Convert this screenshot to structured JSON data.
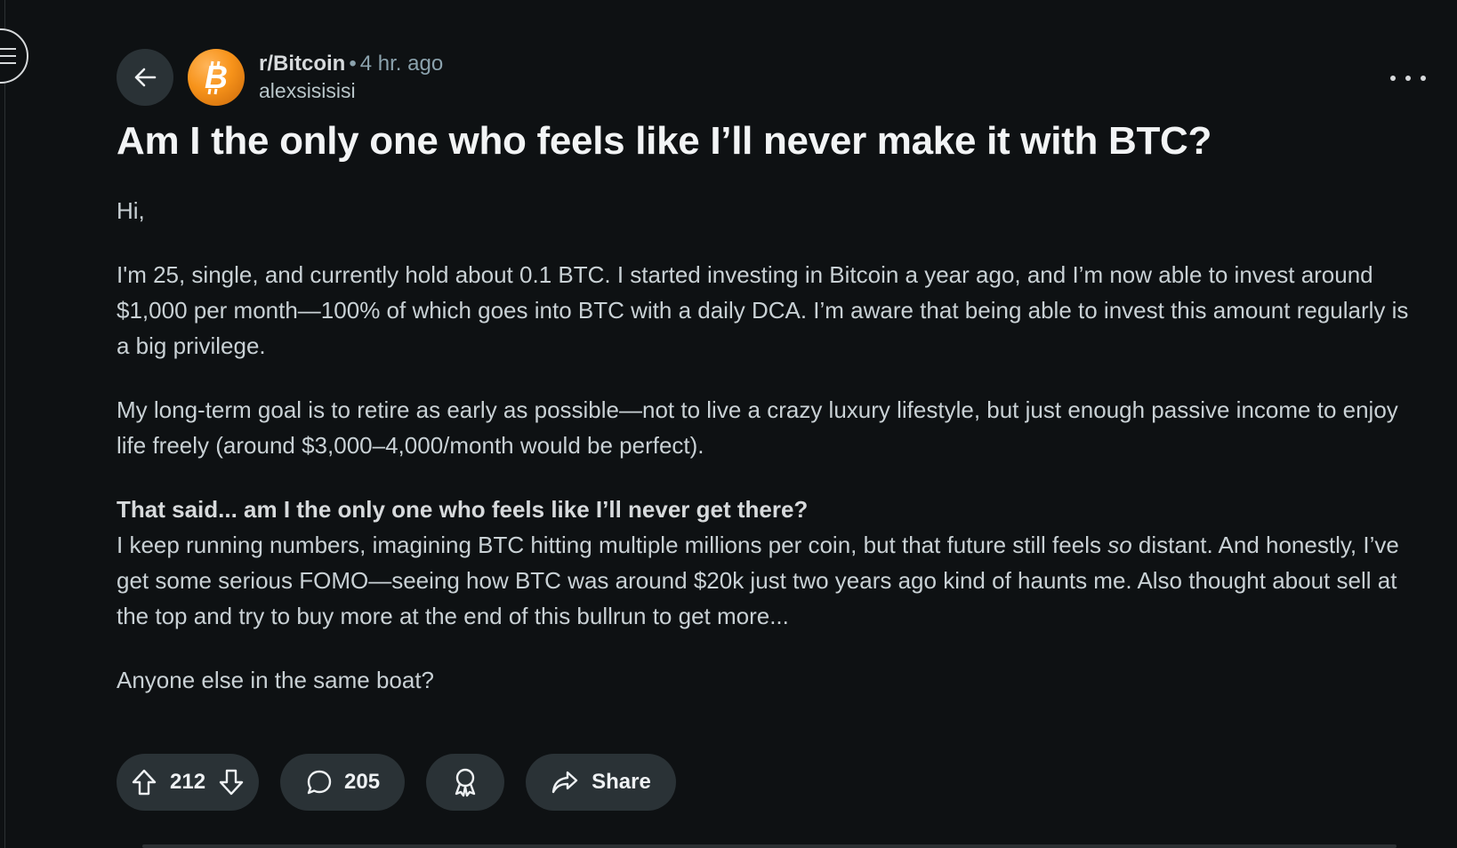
{
  "post": {
    "subreddit": "r/Bitcoin",
    "separator": "•",
    "time_ago": "4 hr. ago",
    "author": "alexsisisisi",
    "title": "Am I the only one who feels like I’ll never make it with BTC?",
    "body": {
      "greeting": "Hi,",
      "para1": "I'm 25, single, and currently hold about 0.1 BTC. I started investing in Bitcoin a year ago, and I’m now able to invest around $1,000 per month—100% of which goes into BTC with a daily DCA. I’m aware that being able to invest this amount regularly is a big privilege.",
      "para2": "My long-term goal is to retire as early as possible—not to live a crazy luxury lifestyle, but just enough passive income to enjoy life freely (around $3,000–4,000/month would be perfect).",
      "bold_line": "That said... am I the only one who feels like I’ll never get there?",
      "para3_part1": "I keep running numbers, imagining BTC hitting multiple millions per coin, but that future still feels ",
      "para3_italic": "so",
      "para3_part2": " distant. And honestly, I’ve get some serious FOMO—seeing how BTC was around $20k just two years ago kind of haunts me. Also thought about sell at the top and try to buy more at the end of this bullrun to get more...",
      "closing": "Anyone else in the same boat?"
    }
  },
  "actions": {
    "upvotes": "212",
    "comments": "205",
    "share_label": "Share"
  },
  "colors": {
    "background": "#0e1113",
    "pill": "#2a3236",
    "bitcoin_orange": "#f7931a"
  },
  "icons": [
    "menu-icon",
    "back-arrow-icon",
    "bitcoin-icon",
    "more-icon",
    "upvote-icon",
    "downvote-icon",
    "comment-icon",
    "award-icon",
    "share-icon"
  ]
}
